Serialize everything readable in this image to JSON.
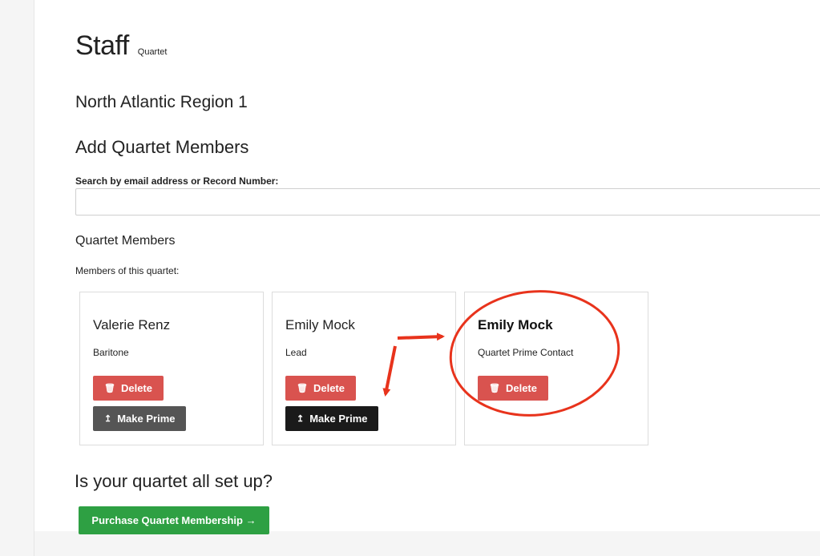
{
  "page": {
    "title": "Staff",
    "title_small": "Quartet",
    "region": "North Atlantic Region 1"
  },
  "add_members": {
    "heading": "Add Quartet Members",
    "search_label": "Search by email address or Record Number:",
    "search_value": "",
    "search_placeholder": ""
  },
  "members": {
    "heading": "Quartet Members",
    "subheading": "Members of this quartet:",
    "cards": [
      {
        "name": "Valerie Renz",
        "role": "Baritone",
        "delete_label": "Delete",
        "prime_label": "Make Prime"
      },
      {
        "name": "Emily Mock",
        "role": "Lead",
        "delete_label": "Delete",
        "prime_label": "Make Prime"
      },
      {
        "name": "Emily Mock",
        "role": "Quartet Prime Contact",
        "delete_label": "Delete"
      }
    ]
  },
  "footer": {
    "question": "Is your quartet all set up?",
    "purchase_label": "Purchase Quartet Membership →"
  },
  "icons": {
    "delete": "trash-icon",
    "make_prime": "level-up-icon"
  },
  "colors": {
    "delete_button": "#d9534f",
    "prime_button": "#555555",
    "prime_button_active": "#1a1a1a",
    "purchase_button": "#2ea043",
    "annotation": "#e8331c"
  }
}
